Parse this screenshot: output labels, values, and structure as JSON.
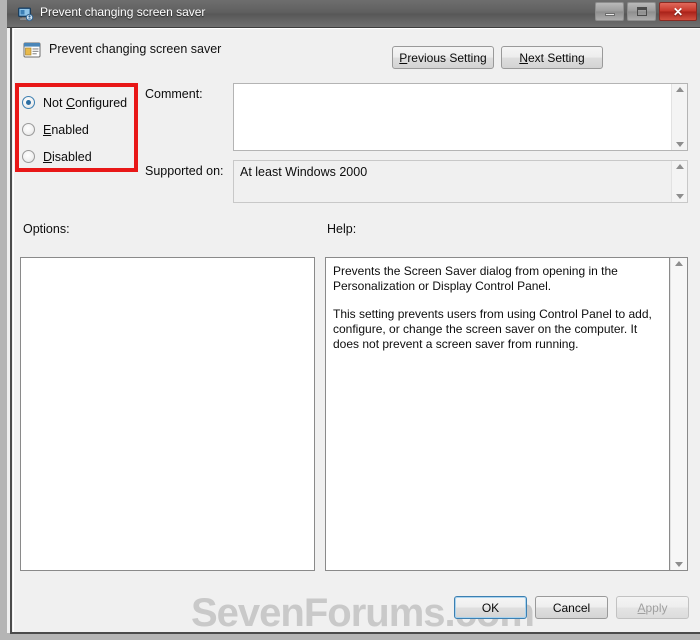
{
  "window": {
    "title": "Prevent changing screen saver",
    "icon": "computer-monitor-icon",
    "controls": {
      "minimize_label": "–",
      "maximize_label": "□",
      "close_label": "✕"
    }
  },
  "header": {
    "icon": "policy-setting-icon",
    "title": "Prevent changing screen saver",
    "previous_setting": {
      "accel": "P",
      "rest": "revious Setting"
    },
    "next_setting": {
      "accel": "N",
      "rest": "ext Setting"
    }
  },
  "state_options": {
    "highlight_color": "#e81717",
    "selected_index": 0,
    "items": [
      {
        "accel_before": "Not ",
        "accel": "C",
        "accel_after": "onfigured",
        "checked": true
      },
      {
        "accel_before": "",
        "accel": "E",
        "accel_after": "nabled",
        "checked": false
      },
      {
        "accel_before": "",
        "accel": "D",
        "accel_after": "isabled",
        "checked": false
      }
    ]
  },
  "comment": {
    "label": "Comment:",
    "value": "",
    "scroll_up_icon": "scroll-up-arrow-icon",
    "scroll_down_icon": "scroll-down-arrow-icon"
  },
  "supported_on": {
    "label": "Supported on:",
    "value": "At least Windows 2000",
    "scroll_up_icon": "scroll-up-arrow-icon",
    "scroll_down_icon": "scroll-down-arrow-icon"
  },
  "options": {
    "label": "Options:",
    "content": ""
  },
  "help": {
    "label": "Help:",
    "paragraphs": [
      "Prevents the Screen Saver dialog from opening in the Personalization or Display Control Panel.",
      "This setting prevents users from using Control Panel to add, configure, or change the screen saver on the computer. It does not prevent a screen saver from running."
    ],
    "scroll_up_icon": "scroll-up-arrow-icon",
    "scroll_down_icon": "scroll-down-arrow-icon"
  },
  "watermark": "SevenForums.com",
  "footer": {
    "ok_label": "OK",
    "cancel_label": "Cancel",
    "apply": {
      "accel": "A",
      "rest": "pply"
    },
    "apply_disabled": true
  }
}
